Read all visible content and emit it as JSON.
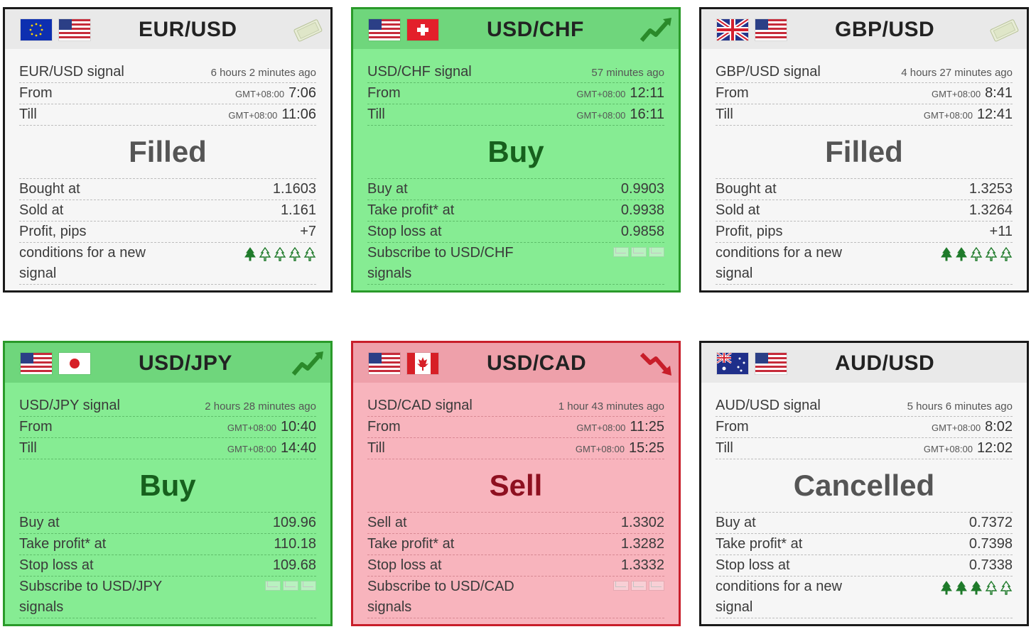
{
  "cards": [
    {
      "pair": "EUR/USD",
      "signal_label": "EUR/USD signal",
      "ago": "6 hours 2 minutes ago",
      "from_label": "From",
      "from_tz": "GMT+08:00",
      "from_time": "7:06",
      "till_label": "Till",
      "till_tz": "GMT+08:00",
      "till_time": "11:06",
      "status": "Filled",
      "row1_label": "Bought at",
      "row1_value": "1.1603",
      "row2_label": "Sold at",
      "row2_value": "1.161",
      "row3_label": "Profit, pips",
      "row3_value": "+7",
      "last_label": "conditions for a new signal",
      "last_icons": "trees",
      "trees_filled": 1,
      "header_icon": "money-icon",
      "flags": [
        "eu-flag-icon",
        "us-flag-icon"
      ]
    },
    {
      "pair": "USD/CHF",
      "signal_label": "USD/CHF signal",
      "ago": "57 minutes ago",
      "from_label": "From",
      "from_tz": "GMT+08:00",
      "from_time": "12:11",
      "till_label": "Till",
      "till_tz": "GMT+08:00",
      "till_time": "16:11",
      "status": "Buy",
      "row1_label": "Buy at",
      "row1_value": "0.9903",
      "row2_label": "Take profit* at",
      "row2_value": "0.9938",
      "row3_label": "Stop loss at",
      "row3_value": "0.9858",
      "last_label": "Subscribe to USD/CHF signals",
      "last_icons": "mail",
      "header_icon": "trend-up-icon",
      "flags": [
        "us-flag-icon",
        "ch-flag-icon"
      ]
    },
    {
      "pair": "GBP/USD",
      "signal_label": "GBP/USD signal",
      "ago": "4 hours 27 minutes ago",
      "from_label": "From",
      "from_tz": "GMT+08:00",
      "from_time": "8:41",
      "till_label": "Till",
      "till_tz": "GMT+08:00",
      "till_time": "12:41",
      "status": "Filled",
      "row1_label": "Bought at",
      "row1_value": "1.3253",
      "row2_label": "Sold at",
      "row2_value": "1.3264",
      "row3_label": "Profit, pips",
      "row3_value": "+11",
      "last_label": "conditions for a new signal",
      "last_icons": "trees",
      "trees_filled": 2,
      "header_icon": "money-icon",
      "flags": [
        "gb-flag-icon",
        "us-flag-icon"
      ]
    },
    {
      "pair": "USD/JPY",
      "signal_label": "USD/JPY signal",
      "ago": "2 hours 28 minutes ago",
      "from_label": "From",
      "from_tz": "GMT+08:00",
      "from_time": "10:40",
      "till_label": "Till",
      "till_tz": "GMT+08:00",
      "till_time": "14:40",
      "status": "Buy",
      "row1_label": "Buy at",
      "row1_value": "109.96",
      "row2_label": "Take profit* at",
      "row2_value": "110.18",
      "row3_label": "Stop loss at",
      "row3_value": "109.68",
      "last_label": "Subscribe to USD/JPY signals",
      "last_icons": "mail",
      "header_icon": "trend-up-icon",
      "flags": [
        "us-flag-icon",
        "jp-flag-icon"
      ]
    },
    {
      "pair": "USD/CAD",
      "signal_label": "USD/CAD signal",
      "ago": "1 hour 43 minutes ago",
      "from_label": "From",
      "from_tz": "GMT+08:00",
      "from_time": "11:25",
      "till_label": "Till",
      "till_tz": "GMT+08:00",
      "till_time": "15:25",
      "status": "Sell",
      "row1_label": "Sell at",
      "row1_value": "1.3302",
      "row2_label": "Take profit* at",
      "row2_value": "1.3282",
      "row3_label": "Stop loss at",
      "row3_value": "1.3332",
      "last_label": "Subscribe to USD/CAD signals",
      "last_icons": "mail",
      "header_icon": "trend-down-icon",
      "flags": [
        "us-flag-icon",
        "ca-flag-icon"
      ]
    },
    {
      "pair": "AUD/USD",
      "signal_label": "AUD/USD signal",
      "ago": "5 hours 6 minutes ago",
      "from_label": "From",
      "from_tz": "GMT+08:00",
      "from_time": "8:02",
      "till_label": "Till",
      "till_tz": "GMT+08:00",
      "till_time": "12:02",
      "status": "Cancelled",
      "row1_label": "Buy at",
      "row1_value": "0.7372",
      "row2_label": "Take profit* at",
      "row2_value": "0.7398",
      "row3_label": "Stop loss at",
      "row3_value": "0.7338",
      "last_label": "conditions for a new signal",
      "last_icons": "trees",
      "trees_filled": 3,
      "header_icon": "",
      "flags": [
        "au-flag-icon",
        "us-flag-icon"
      ]
    }
  ],
  "colors": {
    "buy_bg": "#86ec93",
    "sell_bg": "#f8b4bd",
    "neutral_bg": "#f6f6f6",
    "tree_green": "#1e7a2a"
  }
}
